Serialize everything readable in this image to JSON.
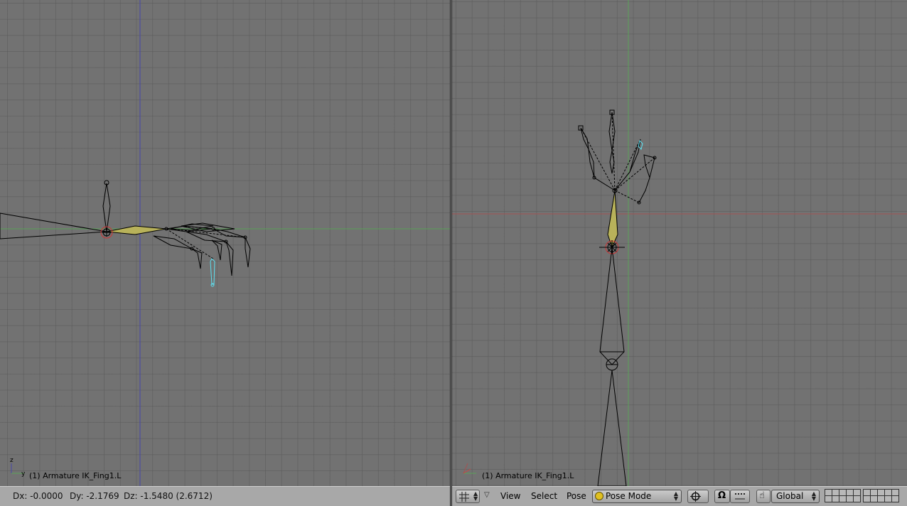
{
  "left_view": {
    "label": "(1) Armature IK_Fing1.L",
    "axis_z": "z",
    "axis_y": "y"
  },
  "right_view": {
    "label": "(1) Armature IK_Fing1.L"
  },
  "status": {
    "dx": "Dx: -0.0000",
    "dy": "Dy: -2.1769",
    "dz": "Dz: -1.5480 (2.6712)"
  },
  "header": {
    "menus": {
      "view": "View",
      "select": "Select",
      "pose": "Pose"
    },
    "mode": "Pose Mode",
    "orientation": "Global"
  },
  "colors": {
    "viewport_bg": "#727272",
    "grid_line": "#5e5e5e",
    "x_axis": "#a25454",
    "y_axis": "#59a258",
    "z_axis": "#4646a8",
    "selected_bone": "#b8b25a",
    "active_bone": "#5ee0f0",
    "header_bg": "#a8a8a8"
  },
  "icons": {
    "editor_type": "grid-icon",
    "mode": "pose-mode-icon",
    "pivot": "pivot-icon",
    "snap": "magnet-icon",
    "manipulator": "hand-icon",
    "layers": "layer-grid-icon"
  }
}
